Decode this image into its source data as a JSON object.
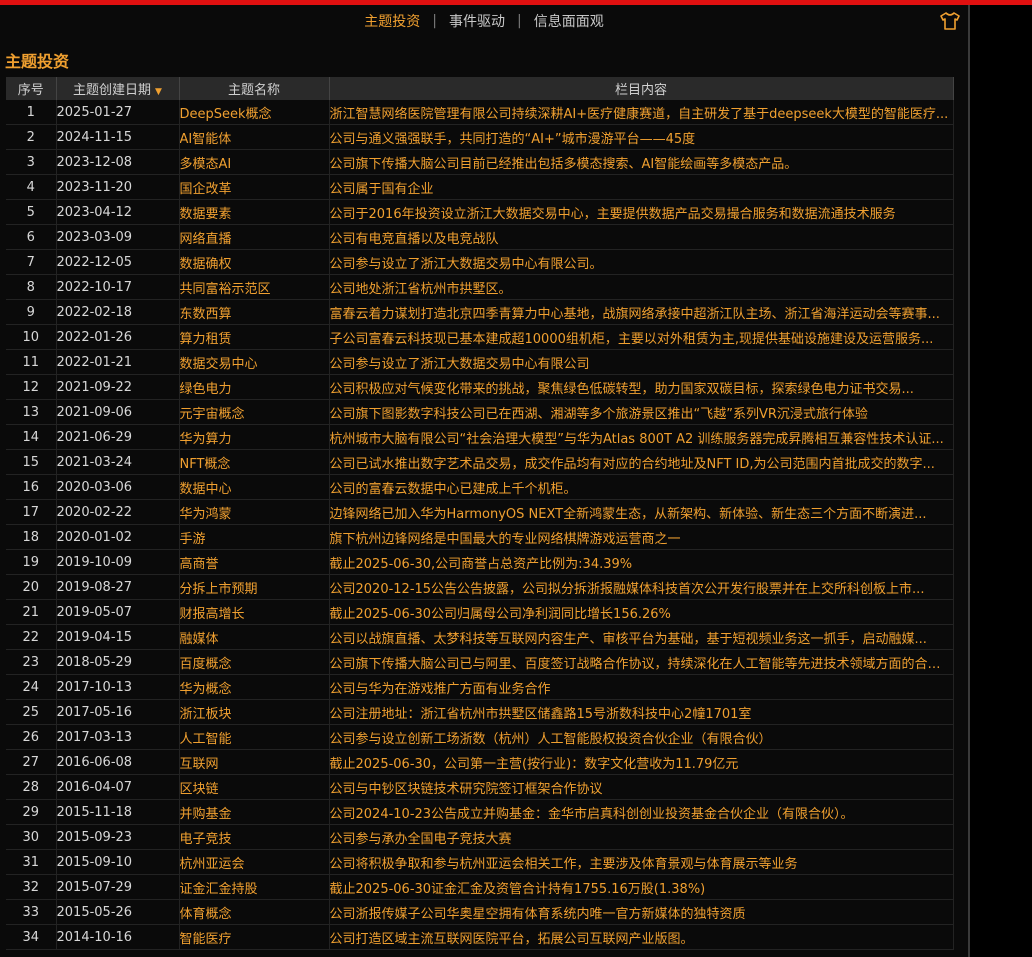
{
  "nav": {
    "tabs": [
      {
        "label": "主题投资",
        "active": true
      },
      {
        "label": "事件驱动",
        "active": false
      },
      {
        "label": "信息面面观",
        "active": false
      }
    ],
    "separator": "|"
  },
  "section_title": "主题投资",
  "table": {
    "columns": [
      "序号",
      "主题创建日期",
      "主题名称",
      "栏目内容"
    ],
    "sort_indicator": "▼",
    "rows": [
      {
        "idx": "1",
        "date": "2025-01-27",
        "name": "DeepSeek概念",
        "content": "浙江智慧网络医院管理有限公司持续深耕AI+医疗健康赛道，自主研发了基于deepseek大模型的智能医疗..."
      },
      {
        "idx": "2",
        "date": "2024-11-15",
        "name": "AI智能体",
        "content": "公司与通义强强联手，共同打造的“AI+”城市漫游平台——45度"
      },
      {
        "idx": "3",
        "date": "2023-12-08",
        "name": "多模态AI",
        "content": "公司旗下传播大脑公司目前已经推出包括多模态搜索、AI智能绘画等多模态产品。"
      },
      {
        "idx": "4",
        "date": "2023-11-20",
        "name": "国企改革",
        "content": "公司属于国有企业"
      },
      {
        "idx": "5",
        "date": "2023-04-12",
        "name": "数据要素",
        "content": "公司于2016年投资设立浙江大数据交易中心，主要提供数据产品交易撮合服务和数据流通技术服务"
      },
      {
        "idx": "6",
        "date": "2023-03-09",
        "name": "网络直播",
        "content": "公司有电竞直播以及电竞战队"
      },
      {
        "idx": "7",
        "date": "2022-12-05",
        "name": "数据确权",
        "content": "公司参与设立了浙江大数据交易中心有限公司。"
      },
      {
        "idx": "8",
        "date": "2022-10-17",
        "name": "共同富裕示范区",
        "content": "公司地处浙江省杭州市拱墅区。"
      },
      {
        "idx": "9",
        "date": "2022-02-18",
        "name": "东数西算",
        "content": "富春云着力谋划打造北京四季青算力中心基地，战旗网络承接中超浙江队主场、浙江省海洋运动会等赛事..."
      },
      {
        "idx": "10",
        "date": "2022-01-26",
        "name": "算力租赁",
        "content": "子公司富春云科技现已基本建成超10000组机柜，主要以对外租赁为主,现提供基础设施建设及运营服务..."
      },
      {
        "idx": "11",
        "date": "2022-01-21",
        "name": "数据交易中心",
        "content": "公司参与设立了浙江大数据交易中心有限公司"
      },
      {
        "idx": "12",
        "date": "2021-09-22",
        "name": "绿色电力",
        "content": "公司积极应对气候变化带来的挑战，聚焦绿色低碳转型，助力国家双碳目标，探索绿色电力证书交易..."
      },
      {
        "idx": "13",
        "date": "2021-09-06",
        "name": "元宇宙概念",
        "content": "公司旗下图影数字科技公司已在西湖、湘湖等多个旅游景区推出“飞越”系列VR沉浸式旅行体验"
      },
      {
        "idx": "14",
        "date": "2021-06-29",
        "name": "华为算力",
        "content": "杭州城市大脑有限公司“社会治理大模型”与华为Atlas 800T A2 训练服务器完成昇腾相互兼容性技术认证..."
      },
      {
        "idx": "15",
        "date": "2021-03-24",
        "name": "NFT概念",
        "content": "公司已试水推出数字艺术品交易，成交作品均有对应的合约地址及NFT ID,为公司范围内首批成交的数字..."
      },
      {
        "idx": "16",
        "date": "2020-03-06",
        "name": "数据中心",
        "content": "公司的富春云数据中心已建成上千个机柜。"
      },
      {
        "idx": "17",
        "date": "2020-02-22",
        "name": "华为鸿蒙",
        "content": "边锋网络已加入华为HarmonyOS NEXT全新鸿蒙生态，从新架构、新体验、新生态三个方面不断演进..."
      },
      {
        "idx": "18",
        "date": "2020-01-02",
        "name": "手游",
        "content": "旗下杭州边锋网络是中国最大的专业网络棋牌游戏运营商之一"
      },
      {
        "idx": "19",
        "date": "2019-10-09",
        "name": "高商誉",
        "content": "截止2025-06-30,公司商誉占总资产比例为:34.39%"
      },
      {
        "idx": "20",
        "date": "2019-08-27",
        "name": "分拆上市预期",
        "content": "公司2020-12-15公告公告披露，公司拟分拆浙报融媒体科技首次公开发行股票并在上交所科创板上市..."
      },
      {
        "idx": "21",
        "date": "2019-05-07",
        "name": "财报高增长",
        "content": "截止2025-06-30公司归属母公司净利润同比增长156.26%"
      },
      {
        "idx": "22",
        "date": "2019-04-15",
        "name": "融媒体",
        "content": "公司以战旗直播、太梦科技等互联网内容生产、审核平台为基础，基于短视频业务这一抓手，启动融媒..."
      },
      {
        "idx": "23",
        "date": "2018-05-29",
        "name": "百度概念",
        "content": "公司旗下传播大脑公司已与阿里、百度签订战略合作协议，持续深化在人工智能等先进技术领域方面的合作..."
      },
      {
        "idx": "24",
        "date": "2017-10-13",
        "name": "华为概念",
        "content": "公司与华为在游戏推广方面有业务合作"
      },
      {
        "idx": "25",
        "date": "2017-05-16",
        "name": "浙江板块",
        "content": "公司注册地址：浙江省杭州市拱墅区储鑫路15号浙数科技中心2幢1701室"
      },
      {
        "idx": "26",
        "date": "2017-03-13",
        "name": "人工智能",
        "content": "公司参与设立创新工场浙数（杭州）人工智能股权投资合伙企业（有限合伙）"
      },
      {
        "idx": "27",
        "date": "2016-06-08",
        "name": "互联网",
        "content": "截止2025-06-30，公司第一主营(按行业)：数字文化营收为11.79亿元"
      },
      {
        "idx": "28",
        "date": "2016-04-07",
        "name": "区块链",
        "content": "公司与中钞区块链技术研究院签订框架合作协议"
      },
      {
        "idx": "29",
        "date": "2015-11-18",
        "name": "并购基金",
        "content": "公司2024-10-23公告成立并购基金：金华市启真科创创业投资基金合伙企业（有限合伙）。"
      },
      {
        "idx": "30",
        "date": "2015-09-23",
        "name": "电子竞技",
        "content": "公司参与承办全国电子竞技大赛"
      },
      {
        "idx": "31",
        "date": "2015-09-10",
        "name": "杭州亚运会",
        "content": "公司将积极争取和参与杭州亚运会相关工作，主要涉及体育景观与体育展示等业务"
      },
      {
        "idx": "32",
        "date": "2015-07-29",
        "name": "证金汇金持股",
        "content": "截止2025-06-30证金汇金及资管合计持有1755.16万股(1.38%)"
      },
      {
        "idx": "33",
        "date": "2015-05-26",
        "name": "体育概念",
        "content": "公司浙报传媒子公司华奥星空拥有体育系统内唯一官方新媒体的独特资质"
      },
      {
        "idx": "34",
        "date": "2014-10-16",
        "name": "智能医疗",
        "content": "公司打造区域主流互联网医院平台，拓展公司互联网产业版图。"
      }
    ]
  }
}
